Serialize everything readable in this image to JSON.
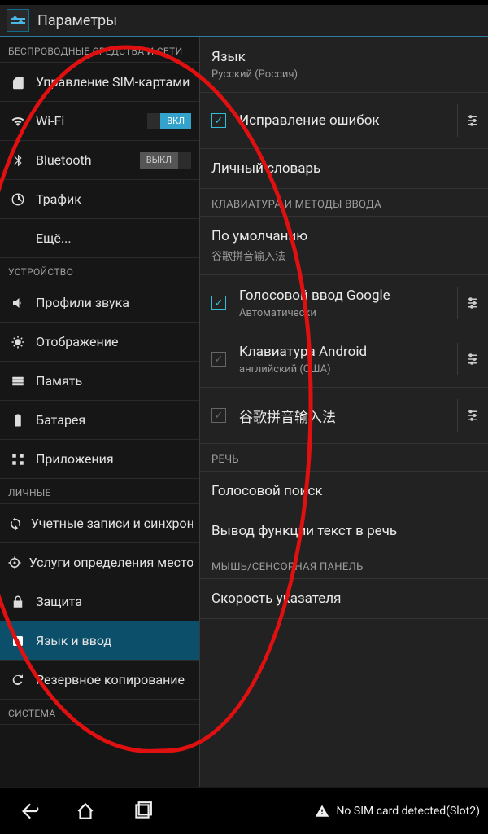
{
  "app_title": "Параметры",
  "sidebar": {
    "sections": [
      {
        "header": "БЕСПРОВОДНЫЕ СРЕДСТВА И СЕТИ",
        "items": [
          {
            "icon": "sim",
            "label": "Управление SIM-картами"
          },
          {
            "icon": "wifi",
            "label": "Wi-Fi",
            "toggle": "on",
            "toggle_label": "ВКЛ"
          },
          {
            "icon": "bt",
            "label": "Bluetooth",
            "toggle": "off",
            "toggle_label": "ВЫКЛ"
          },
          {
            "icon": "data",
            "label": "Трафик"
          },
          {
            "icon": "more",
            "label": "Ещё..."
          }
        ]
      },
      {
        "header": "УСТРОЙСТВО",
        "items": [
          {
            "icon": "audio",
            "label": "Профили звука"
          },
          {
            "icon": "display",
            "label": "Отображение"
          },
          {
            "icon": "storage",
            "label": "Память"
          },
          {
            "icon": "battery",
            "label": "Батарея"
          },
          {
            "icon": "apps",
            "label": "Приложения"
          }
        ]
      },
      {
        "header": "ЛИЧНЫЕ",
        "items": [
          {
            "icon": "sync",
            "label": "Учетные записи и синхронизация"
          },
          {
            "icon": "location",
            "label": "Услуги определения местоположения"
          },
          {
            "icon": "security",
            "label": "Защита"
          },
          {
            "icon": "lang",
            "label": "Язык и ввод",
            "selected": true
          },
          {
            "icon": "backup",
            "label": "Резервное копирование"
          }
        ]
      },
      {
        "header": "СИСТЕМА",
        "items": []
      }
    ]
  },
  "main": {
    "language": {
      "title": "Язык",
      "value": "Русский (Россия)"
    },
    "spellcheck": {
      "label": "Исправление ошибок",
      "checked": true,
      "gear": true
    },
    "dictionary": {
      "label": "Личный словарь"
    },
    "keyboard_section": "КЛАВИАТУРА И МЕТОДЫ ВВОДА",
    "default_ime": {
      "title": "По умолчанию",
      "value": "谷歌拼音输入法"
    },
    "imes": [
      {
        "label": "Голосовой ввод Google",
        "sub": "Автоматически",
        "checked": true,
        "gear": true
      },
      {
        "label": "Клавиатура Android",
        "sub": "английский (США)",
        "checked": false,
        "grey": true,
        "gear": true
      },
      {
        "label": "谷歌拼音输入法",
        "checked": false,
        "grey": true,
        "gear": true
      }
    ],
    "speech_section": "РЕЧЬ",
    "voice_search": "Голосовой поиск",
    "tts": "Вывод функции текст в речь",
    "mouse_section": "МЫШЬ/СЕНСОРНАЯ ПАНЕЛЬ",
    "pointer_speed": "Скорость указателя"
  },
  "navbar": {
    "no_sim": "No SIM card detected(Slot2)"
  }
}
